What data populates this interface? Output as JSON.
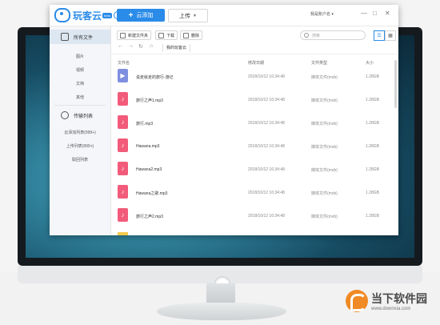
{
  "app": {
    "logo_text": "玩客云",
    "logo_badge": "beta",
    "add_button": "云添加",
    "upload_button": "上传",
    "account": "我是账户名",
    "win_controls": [
      "—",
      "□",
      "✕"
    ]
  },
  "sidebar": {
    "all_files": "所有文件",
    "categories": [
      "图片",
      "视频",
      "文档",
      "其他"
    ],
    "transfer_list": "传输列表",
    "transfers": [
      "云添加列表(999+)",
      "上传列表(999+)",
      "取回列表"
    ]
  },
  "toolbar": {
    "new_folder": "新建文件夹",
    "download": "下载",
    "delete": "删除",
    "search_placeholder": "搜索"
  },
  "nav": {
    "back": "←",
    "forward": "→",
    "refresh": "↻",
    "home": "⌂",
    "breadcrumb": "我的玩客云"
  },
  "table": {
    "headers": {
      "name": "文件名",
      "date": "修改日期",
      "type": "文件类型",
      "size": "大小"
    },
    "rows": [
      {
        "name": "说走就走的旅行-游记",
        "date": "2018/10/12 16:34:48",
        "type": "媒体文件(mvb)",
        "size": "1.28GB",
        "icon": "video-file-icon"
      },
      {
        "name": "旅行之声1.mp3",
        "date": "2018/10/12 16:34:48",
        "type": "媒体文件(mvb)",
        "size": "1.28GB",
        "icon": "music-file-icon"
      },
      {
        "name": "旅行.mp3",
        "date": "2018/10/12 16:34:48",
        "type": "媒体文件(mvb)",
        "size": "1.28GB",
        "icon": "music-file-icon"
      },
      {
        "name": "Hawana.mp3",
        "date": "2018/10/12 16:34:48",
        "type": "媒体文件(mvb)",
        "size": "1.28GB",
        "icon": "music-file-icon"
      },
      {
        "name": "Hawana2.mp3",
        "date": "2018/10/12 16:34:48",
        "type": "媒体文件(mvb)",
        "size": "1.28GB",
        "icon": "music-file-icon"
      },
      {
        "name": "Hawana之歌.mp3",
        "date": "2018/10/12 16:34:48",
        "type": "媒体文件(mvb)",
        "size": "1.28GB",
        "icon": "music-file-icon"
      },
      {
        "name": "旅行之声2.mp3",
        "date": "2018/10/12 16:34:48",
        "type": "媒体文件(mvb)",
        "size": "1.28GB",
        "icon": "music-file-icon"
      }
    ]
  },
  "watermark": {
    "name": "当下软件园",
    "url": "www.downxia.com"
  },
  "colors": {
    "accent": "#2b8be8",
    "music": "#f25b7a",
    "folder": "#f4c94e",
    "brand": "#f08a24"
  }
}
